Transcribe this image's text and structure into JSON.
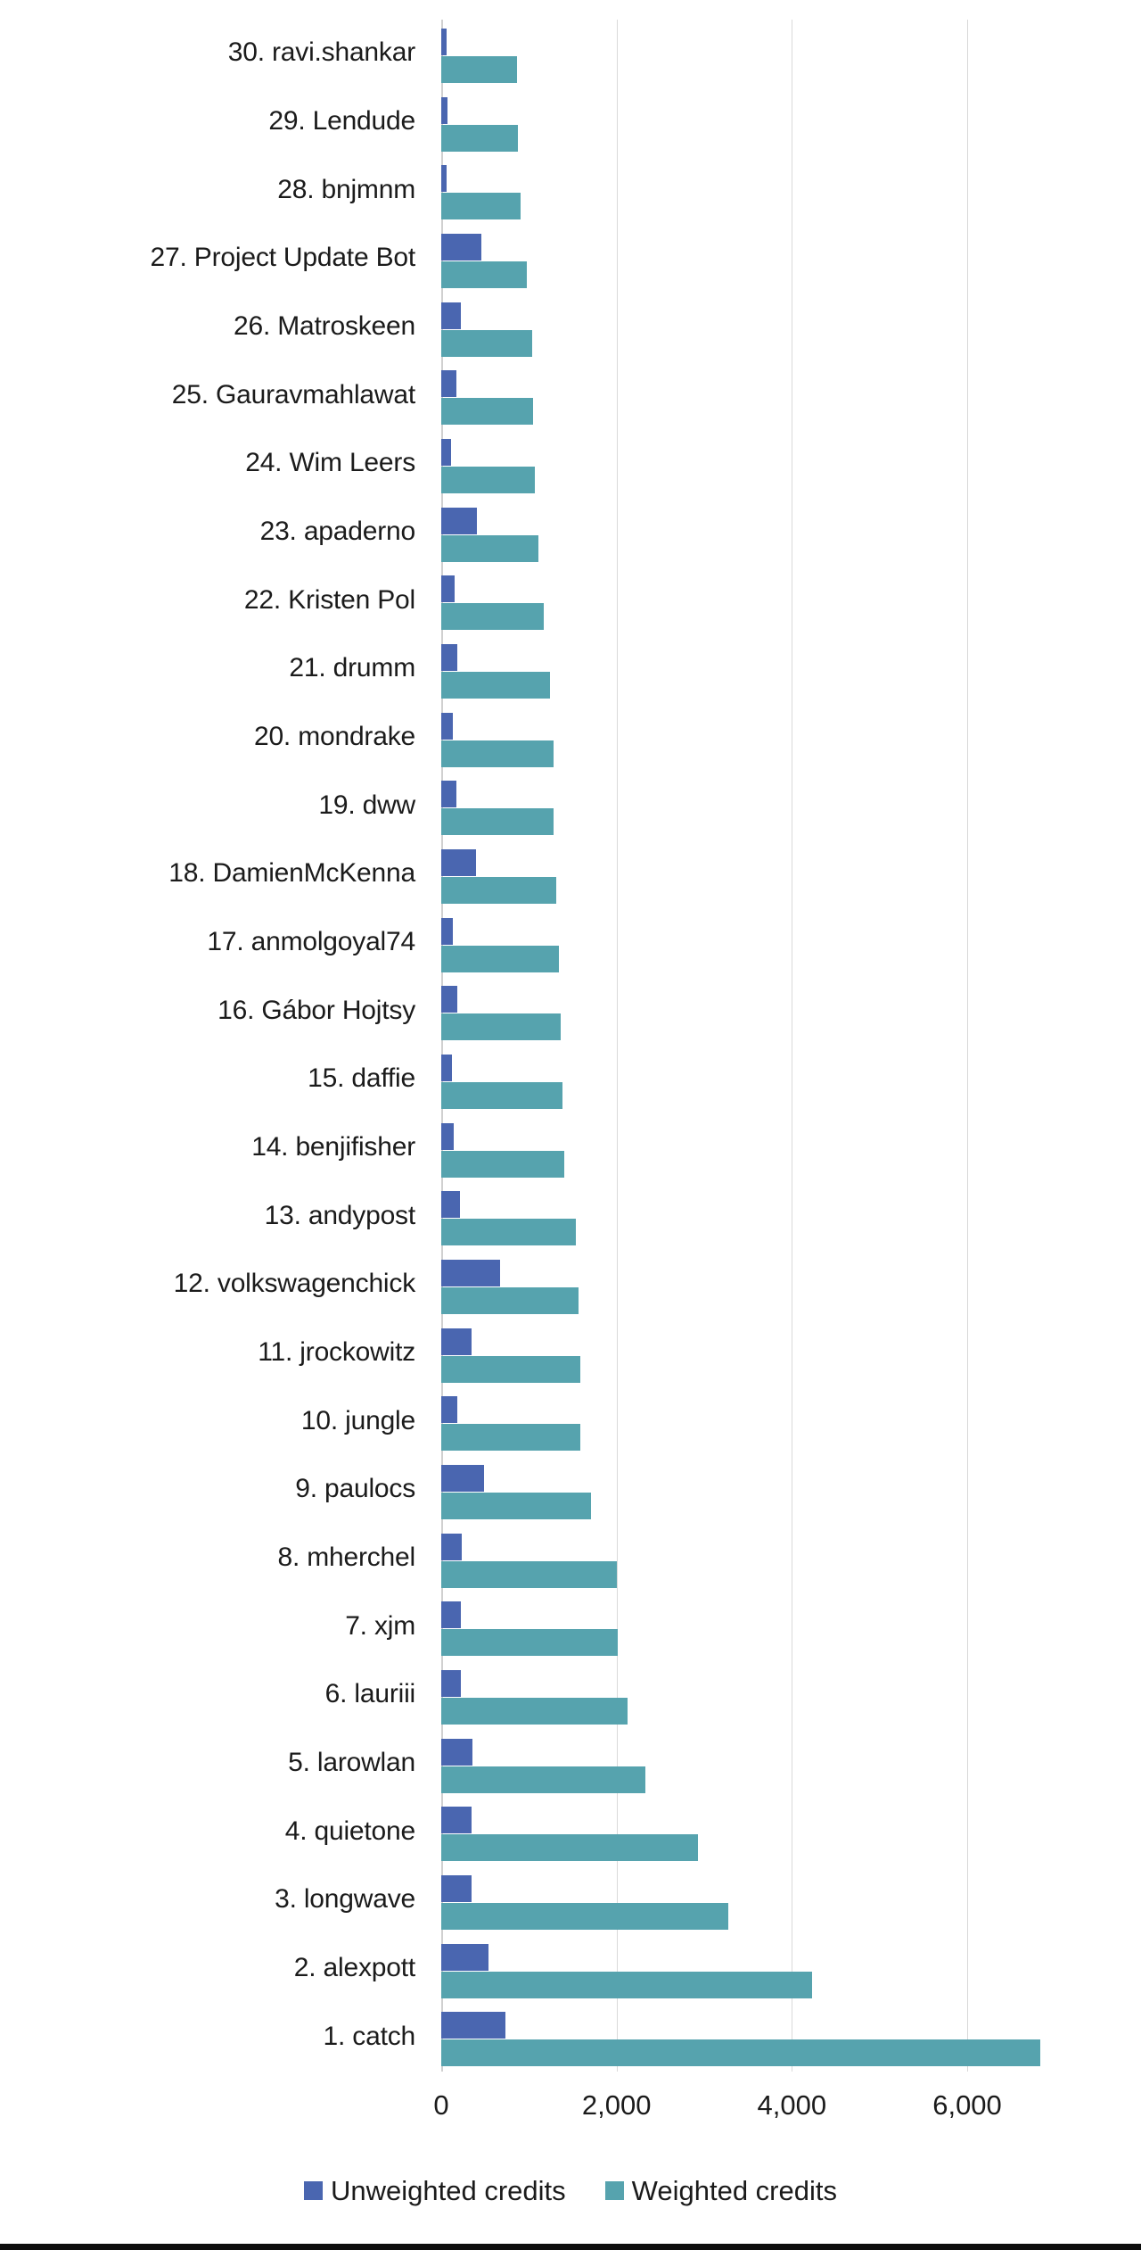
{
  "chart_data": {
    "type": "bar",
    "orientation": "horizontal",
    "title": "",
    "xlabel": "",
    "ylabel": "",
    "xlim": [
      0,
      7000
    ],
    "xticks": [
      0,
      2000,
      4000,
      6000
    ],
    "xtick_labels": [
      "0",
      "2,000",
      "4,000",
      "6,000"
    ],
    "grid": true,
    "legend_position": "bottom",
    "colors": {
      "unweighted": "#4a66b0",
      "weighted": "#56a3ae",
      "gridline": "#d9d9d9",
      "text": "#1b1b1b",
      "background": "#ffffff"
    },
    "categories": [
      "30. ravi.shankar",
      "29. Lendude",
      "28. bnjmnm",
      "27. Project Update Bot",
      "26. Matroskeen",
      "25. Gauravmahlawat",
      "24. Wim Leers",
      "23. apaderno",
      "22. Kristen Pol",
      "21. drumm",
      "20. mondrake",
      "19. dww",
      "18. DamienMcKenna",
      "17. anmolgoyal74",
      "16. Gábor Hojtsy",
      "15. daffie",
      "14. benjifisher",
      "13. andypost",
      "12. volkswagenchick",
      "11. jrockowitz",
      "10. jungle",
      "9. paulocs",
      "8. mherchel",
      "7. xjm",
      "6. lauriii",
      "5. larowlan",
      "4. quietone",
      "3. longwave",
      "2. alexpott",
      "1. catch"
    ],
    "series": [
      {
        "name": "Unweighted credits",
        "color": "#4a66b0",
        "values": [
          61,
          71,
          66,
          458,
          224,
          173,
          112,
          407,
          153,
          178,
          132,
          173,
          397,
          137,
          188,
          122,
          142,
          214,
          672,
          341,
          188,
          488,
          234,
          224,
          224,
          356,
          341,
          341,
          540,
          733
        ]
      },
      {
        "name": "Weighted credits",
        "color": "#56a3ae",
        "values": [
          860,
          875,
          900,
          977,
          1038,
          1048,
          1068,
          1109,
          1170,
          1241,
          1282,
          1282,
          1312,
          1343,
          1363,
          1383,
          1404,
          1536,
          1566,
          1587,
          1587,
          1709,
          2008,
          2018,
          2130,
          2333,
          2932,
          3272,
          4232,
          6836
        ]
      }
    ]
  },
  "legend": {
    "items": [
      {
        "label": "Unweighted credits",
        "color": "#4a66b0"
      },
      {
        "label": "Weighted credits",
        "color": "#56a3ae"
      }
    ]
  }
}
